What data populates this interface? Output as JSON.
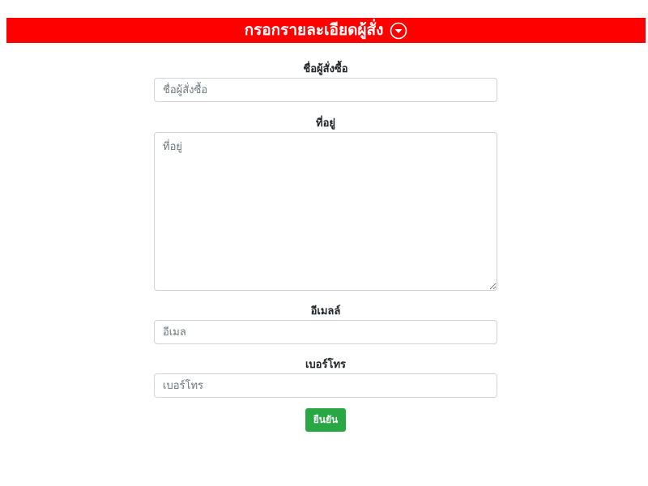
{
  "header": {
    "title": "กรอกรายละเอียดผู้สั่ง",
    "toggle_icon": "chevron-down-circle-icon",
    "background_color": "#ff0000"
  },
  "form": {
    "name": {
      "label": "ชื่อผู้สั่งซื้อ",
      "placeholder": "ชื่อผู้สั่งซื้อ",
      "value": ""
    },
    "address": {
      "label": "ที่อยู่",
      "placeholder": "ที่อยู่",
      "value": ""
    },
    "email": {
      "label": "อีเมลล์",
      "placeholder": "อีเมล",
      "value": ""
    },
    "phone": {
      "label": "เบอร์โทร",
      "placeholder": "เบอร์โทร",
      "value": ""
    },
    "submit_label": "ยืนยัน",
    "submit_color": "#28a745"
  }
}
